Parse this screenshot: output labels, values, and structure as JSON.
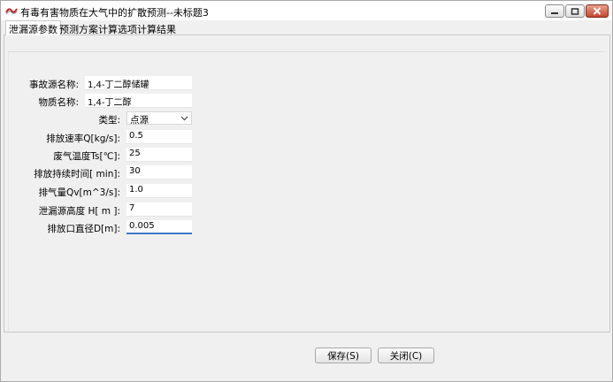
{
  "window": {
    "title": "有毒有害物质在大气中的扩散预测--未标题3"
  },
  "tabs": [
    {
      "label": "泄漏源参数"
    },
    {
      "label": "预测方案"
    },
    {
      "label": "计算选项"
    },
    {
      "label": "计算结果"
    }
  ],
  "form": {
    "source_name": {
      "label": "事故源名称:",
      "value": "1,4-丁二醇储罐"
    },
    "substance_name": {
      "label": "物质名称:",
      "value": "1,4-丁二醇"
    },
    "type": {
      "label": "类型:",
      "value": "点源"
    },
    "emission_rate": {
      "label": "排放速率Q[kg/s]:",
      "value": "0.5"
    },
    "exhaust_temp": {
      "label": "废气温度Ts[℃]:",
      "value": "25"
    },
    "duration": {
      "label": "排放持续时间[ min]:",
      "value": "30"
    },
    "exhaust_volume": {
      "label": "排气量Qv[m^3/s]:",
      "value": "1.0"
    },
    "leak_height": {
      "label": "泄漏源高度 H[  m  ]:",
      "value": "7"
    },
    "outlet_diameter": {
      "label": "排放口直径D[m]:",
      "value": "0.005"
    }
  },
  "buttons": {
    "save": "保存(S)",
    "close": "关闭(C)"
  },
  "colors": {
    "focus_underline": "#3c78c8",
    "close_button": "#c8452f"
  }
}
